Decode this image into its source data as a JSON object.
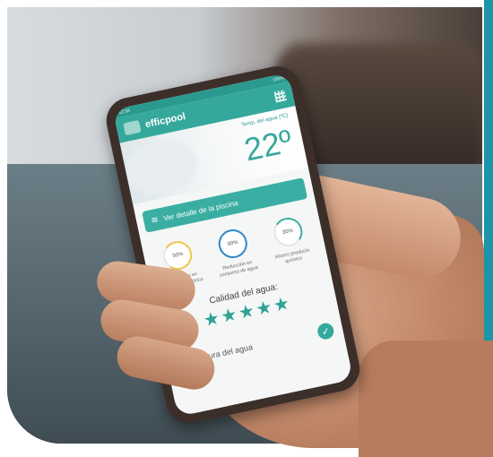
{
  "app": {
    "status_time": "12:34",
    "status_right": "100%",
    "title": "efficpool"
  },
  "hero": {
    "temp_label": "Temp. del agua (ºC)",
    "temp_value": "22º"
  },
  "detail_button": {
    "label": "Ver detalle de la piscina"
  },
  "stats": [
    {
      "value": "50%",
      "label": "Reducción en consumo eléctrico"
    },
    {
      "value": "90%",
      "label": "Reducción en consumo de agua"
    },
    {
      "value": "30%",
      "label": "Ahorro producto químico"
    }
  ],
  "quality": {
    "label": "Calidad del agua:",
    "stars": 5,
    "stars_text": "★★★★★"
  },
  "temp_section": {
    "label": "Temperatura del agua"
  },
  "icons": [
    "logo-icon",
    "qr-icon",
    "pool-icon",
    "check-icon"
  ],
  "colors": {
    "accent": "#35a89c",
    "stripe": "#1b95a8"
  }
}
